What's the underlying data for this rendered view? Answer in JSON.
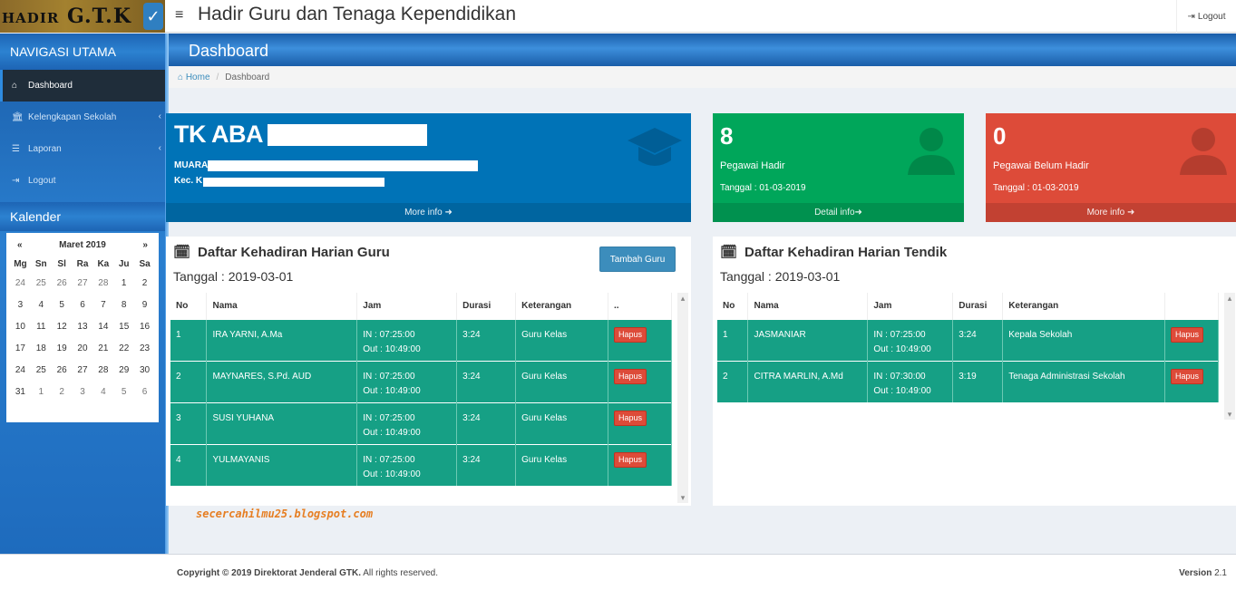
{
  "header": {
    "logo_text_main": "HADIR",
    "logo_text_gtk": "G.T.K",
    "menu_icon": "hamburger-icon",
    "title": "Hadir Guru dan Tenaga Kependidikan",
    "logout_label": "Logout"
  },
  "sidebar": {
    "nav_heading": "NAVIGASI UTAMA",
    "items": [
      {
        "label": "Dashboard",
        "icon": "home-icon",
        "active": true
      },
      {
        "label": "Kelengkapan Sekolah",
        "icon": "bank-icon"
      },
      {
        "label": "Laporan",
        "icon": "list-icon"
      },
      {
        "label": "Logout",
        "icon": "sign-out-icon"
      }
    ],
    "calendar_heading": "Kalender",
    "calendar": {
      "prev": "«",
      "next": "»",
      "month": "Maret 2019",
      "days": [
        "Mg",
        "Sn",
        "Sl",
        "Ra",
        "Ka",
        "Ju",
        "Sa"
      ],
      "weeks": [
        [
          "24",
          "25",
          "26",
          "27",
          "28",
          "1",
          "2"
        ],
        [
          "3",
          "4",
          "5",
          "6",
          "7",
          "8",
          "9"
        ],
        [
          "10",
          "11",
          "12",
          "13",
          "14",
          "15",
          "16"
        ],
        [
          "17",
          "18",
          "19",
          "20",
          "21",
          "22",
          "23"
        ],
        [
          "24",
          "25",
          "26",
          "27",
          "28",
          "29",
          "30"
        ],
        [
          "31",
          "1",
          "2",
          "3",
          "4",
          "5",
          "6"
        ]
      ]
    }
  },
  "page": {
    "heading": "Dashboard",
    "breadcrumb_home": "Home",
    "breadcrumb_current": "Dashboard"
  },
  "school_box": {
    "name": "TK ABA",
    "line1": "MUARA",
    "line2": "Kec. K",
    "more": "More info"
  },
  "hadir_box": {
    "count": "8",
    "label": "Pegawai Hadir",
    "date": "Tanggal : 01-03-2019",
    "more": "Detail info"
  },
  "belum_box": {
    "count": "0",
    "label": "Pegawai Belum Hadir",
    "date": "Tanggal : 01-03-2019",
    "more": "More info"
  },
  "guru_panel": {
    "title": "Daftar Kehadiran Harian Guru",
    "date": "Tanggal : 2019-03-01",
    "add_button": "Tambah Guru",
    "columns": [
      "No",
      "Nama",
      "Jam",
      "Durasi",
      "Keterangan",
      ".."
    ],
    "rows": [
      {
        "no": "1",
        "nama": "IRA YARNI, A.Ma",
        "in": "IN : 07:25:00",
        "out": "Out : 10:49:00",
        "durasi": "3:24",
        "ket": "Guru Kelas",
        "aksi": "Hapus"
      },
      {
        "no": "2",
        "nama": "MAYNARES, S.Pd. AUD",
        "in": "IN : 07:25:00",
        "out": "Out : 10:49:00",
        "durasi": "3:24",
        "ket": "Guru Kelas",
        "aksi": "Hapus"
      },
      {
        "no": "3",
        "nama": "SUSI YUHANA",
        "in": "IN : 07:25:00",
        "out": "Out : 10:49:00",
        "durasi": "3:24",
        "ket": "Guru Kelas",
        "aksi": "Hapus"
      },
      {
        "no": "4",
        "nama": "YULMAYANIS",
        "in": "IN : 07:25:00",
        "out": "Out : 10:49:00",
        "durasi": "3:24",
        "ket": "Guru Kelas",
        "aksi": "Hapus"
      }
    ]
  },
  "tendik_panel": {
    "title": "Daftar Kehadiran Harian Tendik",
    "date": "Tanggal : 2019-03-01",
    "columns": [
      "No",
      "Nama",
      "Jam",
      "Durasi",
      "Keterangan",
      ""
    ],
    "rows": [
      {
        "no": "1",
        "nama": "JASMANIAR",
        "in": "IN : 07:25:00",
        "out": "Out : 10:49:00",
        "durasi": "3:24",
        "ket": "Kepala Sekolah",
        "aksi": "Hapus"
      },
      {
        "no": "2",
        "nama": "CITRA MARLIN, A.Md",
        "in": "IN : 07:30:00",
        "out": "Out : 10:49:00",
        "durasi": "3:19",
        "ket": "Tenaga Administrasi Sekolah",
        "aksi": "Hapus"
      }
    ]
  },
  "watermark": "secercahilmu25.blogspot.com",
  "footer": {
    "copyright_bold": "Copyright © 2019 Direktorat Jenderal GTK.",
    "copyright_rest": " All rights reserved.",
    "version_label": "Version",
    "version_value": " 2.1"
  }
}
